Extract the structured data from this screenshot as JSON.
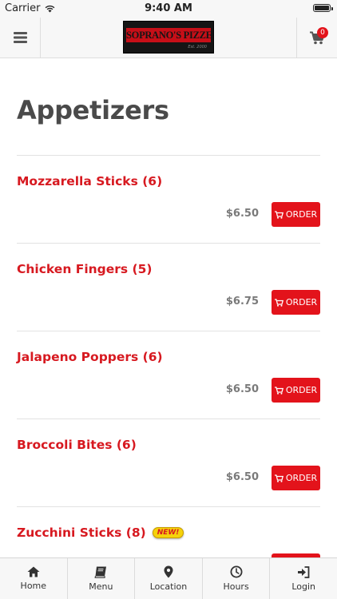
{
  "status_bar": {
    "carrier": "Carrier",
    "time": "9:40 AM"
  },
  "header": {
    "logo_text": "SOPRANO'S PIZZERIA",
    "logo_subtext": "Est. 2000",
    "cart_count": "0"
  },
  "page": {
    "title": "Appetizers"
  },
  "order_label": "ORDER",
  "items": [
    {
      "name": "Mozzarella Sticks (6)",
      "price": "$6.50"
    },
    {
      "name": "Chicken Fingers (5)",
      "price": "$6.75"
    },
    {
      "name": "Jalapeno Poppers (6)",
      "price": "$6.50"
    },
    {
      "name": "Broccoli Bites (6)",
      "price": "$6.50"
    },
    {
      "name": "Zucchini Sticks (8)",
      "price": "",
      "badge": "NEW!"
    }
  ],
  "tabs": [
    {
      "label": "Home",
      "icon": "home-icon"
    },
    {
      "label": "Menu",
      "icon": "book-icon"
    },
    {
      "label": "Location",
      "icon": "map-pin-icon"
    },
    {
      "label": "Hours",
      "icon": "clock-icon"
    },
    {
      "label": "Login",
      "icon": "login-icon"
    }
  ],
  "colors": {
    "accent": "#e3131b",
    "title": "#4a4a4a",
    "price": "#7a7a7a"
  }
}
